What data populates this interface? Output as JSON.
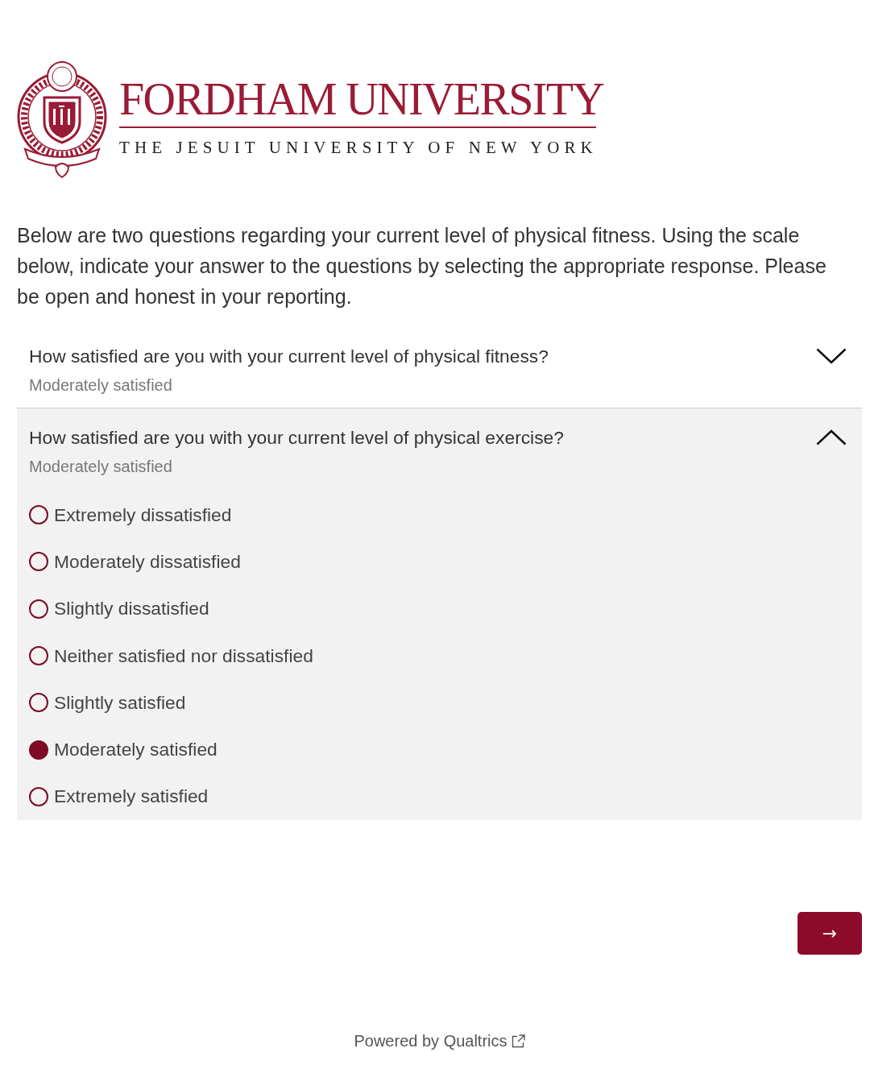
{
  "header": {
    "title": "FORDHAM UNIVERSITY",
    "tagline": "THE JESUIT UNIVERSITY OF NEW YORK"
  },
  "intro": "Below are two questions regarding your current level of physical fitness. Using the scale below, indicate your answer to the questions by selecting the appropriate response. Please be open and honest in your reporting.",
  "questions": [
    {
      "text": "How satisfied are you with your current level of physical fitness?",
      "answer": "Moderately satisfied",
      "expanded": false
    },
    {
      "text": "How satisfied are you with your current level of physical exercise?",
      "answer": "Moderately satisfied",
      "expanded": true,
      "options": [
        {
          "label": "Extremely dissatisfied",
          "selected": false
        },
        {
          "label": "Moderately dissatisfied",
          "selected": false
        },
        {
          "label": "Slightly dissatisfied",
          "selected": false
        },
        {
          "label": "Neither satisfied nor dissatisfied",
          "selected": false
        },
        {
          "label": "Slightly satisfied",
          "selected": false
        },
        {
          "label": "Moderately satisfied",
          "selected": true
        },
        {
          "label": "Extremely satisfied",
          "selected": false
        }
      ]
    }
  ],
  "next_button": {
    "label": "→"
  },
  "footer": {
    "text": "Powered by Qualtrics"
  }
}
